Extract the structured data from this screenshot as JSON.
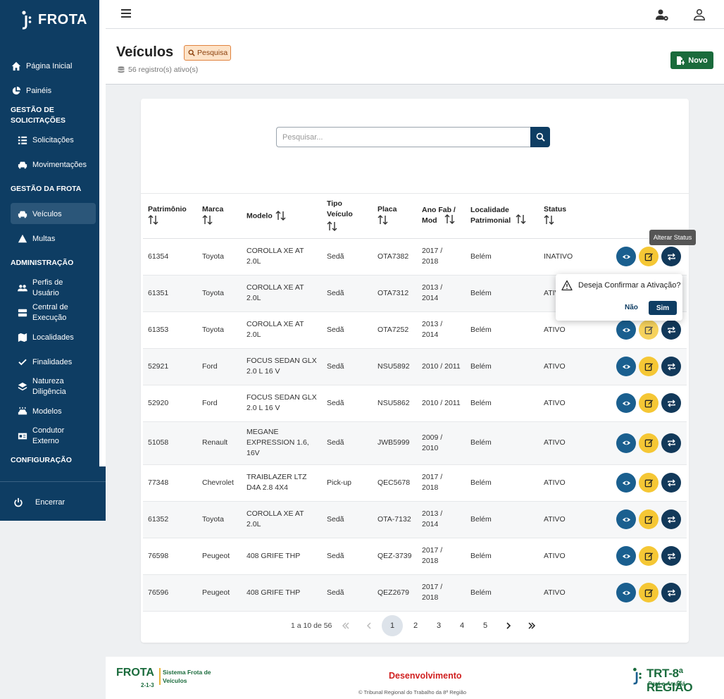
{
  "app": {
    "brand": "FROTA"
  },
  "sidebar": {
    "items": [
      {
        "label": "Página Inicial",
        "icon": "home-icon"
      },
      {
        "label": "Painéis",
        "icon": "pie-chart-icon"
      }
    ],
    "sections": [
      {
        "title": "GESTÃO DE SOLICITAÇÕES",
        "items": [
          {
            "label": "Solicitações",
            "icon": "list-icon"
          },
          {
            "label": "Movimentações",
            "icon": "car-icon"
          }
        ]
      },
      {
        "title": "GESTÃO DA FROTA",
        "items": [
          {
            "label": "Veículos",
            "icon": "car-icon",
            "active": true
          },
          {
            "label": "Multas",
            "icon": "warning-icon"
          }
        ]
      },
      {
        "title": "ADMINISTRAÇÃO",
        "items": [
          {
            "label": "Perfis de Usuário",
            "icon": "users-icon"
          },
          {
            "label": "Central de Execução",
            "icon": "server-icon"
          },
          {
            "label": "Localidades",
            "icon": "map-icon"
          },
          {
            "label": "Finalidades",
            "icon": "check-icon"
          },
          {
            "label": "Natureza Diligência",
            "icon": "layers-icon"
          },
          {
            "label": "Modelos",
            "icon": "car-side-icon"
          },
          {
            "label": "Condutor Externo",
            "icon": "id-card-icon"
          }
        ]
      },
      {
        "title": "CONFIGURAÇÃO",
        "items": []
      }
    ],
    "logout_label": "Encerrar"
  },
  "header": {
    "title": "Veículos",
    "badge": "Pesquisa",
    "count": "56 registro(s) ativo(s)",
    "new_button": "Novo"
  },
  "search": {
    "placeholder": "Pesquisar..."
  },
  "table": {
    "columns": [
      "Patrimônio",
      "Marca",
      "Modelo",
      "Tipo Veículo",
      "Placa",
      "Ano Fab / Mod",
      "Localidade Patrimonial",
      "Status"
    ],
    "rows": [
      [
        "61354",
        "Toyota",
        "COROLLA XE AT 2.0L",
        "Sedã",
        "OTA7382",
        "2017 / 2018",
        "Belém",
        "INATIVO"
      ],
      [
        "61351",
        "Toyota",
        "COROLLA XE AT 2.0L",
        "Sedã",
        "OTA7312",
        "2013 / 2014",
        "Belém",
        "ATIVO"
      ],
      [
        "61353",
        "Toyota",
        "COROLLA XE AT 2.0L",
        "Sedã",
        "OTA7252",
        "2013 / 2014",
        "Belém",
        "ATIVO"
      ],
      [
        "52921",
        "Ford",
        "FOCUS SEDAN GLX 2.0 L 16 V",
        "Sedã",
        "NSU5892",
        "2010 / 2011",
        "Belém",
        "ATIVO"
      ],
      [
        "52920",
        "Ford",
        "FOCUS SEDAN GLX 2.0 L 16 V",
        "Sedã",
        "NSU5862",
        "2010 / 2011",
        "Belém",
        "ATIVO"
      ],
      [
        "51058",
        "Renault",
        "MEGANE EXPRESSION 1.6, 16V",
        "Sedã",
        "JWB5999",
        "2009 / 2010",
        "Belém",
        "ATIVO"
      ],
      [
        "77348",
        "Chevrolet",
        "TRAIBLAZER LTZ D4A 2.8 4X4",
        "Pick-up",
        "QEC5678",
        "2017 / 2018",
        "Belém",
        "ATIVO"
      ],
      [
        "61352",
        "Toyota",
        "COROLLA XE AT 2.0L",
        "Sedã",
        "OTA-7132",
        "2013 / 2014",
        "Belém",
        "ATIVO"
      ],
      [
        "76598",
        "Peugeot",
        "408 GRIFE THP",
        "Sedã",
        "QEZ-3739",
        "2017 / 2018",
        "Belém",
        "ATIVO"
      ],
      [
        "76596",
        "Peugeot",
        "408 GRIFE THP",
        "Sedã",
        "QEZ2679",
        "2017 / 2018",
        "Belém",
        "ATIVO"
      ]
    ]
  },
  "pagination": {
    "info": "1 a 10 de 56",
    "pages": [
      "1",
      "2",
      "3",
      "4",
      "5"
    ],
    "current": "1"
  },
  "tooltip": {
    "text": "Alterar Status"
  },
  "popover": {
    "message": "Deseja Confirmar a Ativação?",
    "no": "Não",
    "yes": "Sim"
  },
  "footer": {
    "brand": "FROTA",
    "version": "2-1-3",
    "system": "Sistema Frota de Veículos",
    "environment": "Desenvolvimento",
    "copyright": "© Tribunal Regional do Trabalho da 8ª Região",
    "org": "TRT-8ª REGIÃO",
    "org_sub": "Pará e Amapá"
  },
  "colors": {
    "sidebar": "#0e3d63",
    "accent_green": "#1a6b3c",
    "warning_yellow": "#f5c735",
    "env_red": "#d01f1f"
  }
}
